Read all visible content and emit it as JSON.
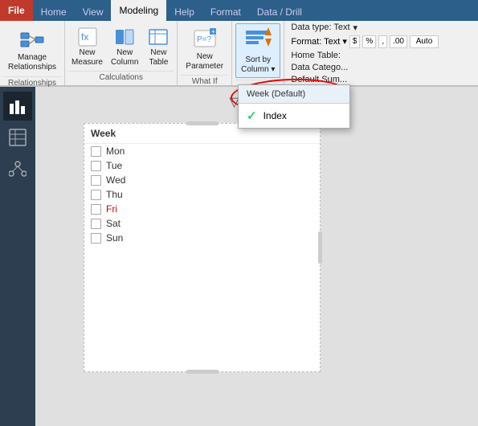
{
  "tabs": [
    {
      "label": "File",
      "active": false,
      "id": "file"
    },
    {
      "label": "Home",
      "active": false,
      "id": "home"
    },
    {
      "label": "View",
      "active": false,
      "id": "view"
    },
    {
      "label": "Modeling",
      "active": true,
      "id": "modeling"
    },
    {
      "label": "Help",
      "active": false,
      "id": "help"
    },
    {
      "label": "Format",
      "active": false,
      "id": "format"
    },
    {
      "label": "Data / Drill",
      "active": false,
      "id": "data-drill"
    }
  ],
  "ribbon": {
    "groups": [
      {
        "id": "relationships",
        "label": "Relationships",
        "buttons": [
          {
            "id": "manage-relationships",
            "label": "Manage\nRelationships",
            "icon": "rel"
          }
        ]
      },
      {
        "id": "calculations",
        "label": "Calculations",
        "buttons": [
          {
            "id": "new-measure",
            "label": "New\nMeasure",
            "icon": "measure"
          },
          {
            "id": "new-column",
            "label": "New\nColumn",
            "icon": "column"
          },
          {
            "id": "new-table",
            "label": "New\nTable",
            "icon": "table"
          }
        ]
      },
      {
        "id": "what-if",
        "label": "What If",
        "buttons": [
          {
            "id": "new-parameter",
            "label": "New\nParameter",
            "icon": "param"
          }
        ]
      },
      {
        "id": "sort",
        "label": "",
        "buttons": [
          {
            "id": "sort-by-column",
            "label": "Sort by\nColumn",
            "icon": "sort"
          }
        ]
      }
    ],
    "right_panel": {
      "data_type_label": "Data type: Text",
      "format_label": "Format: Text",
      "home_table_label": "Home Table:",
      "data_category_label": "Data Catego...",
      "default_sum_label": "Default Sum..."
    },
    "format_bar": {
      "dollar": "$",
      "percent": "%",
      "comma": ",",
      "decimal_more": ".00",
      "auto_label": "Auto"
    }
  },
  "dropdown": {
    "header": "Week (Default)",
    "items": [
      {
        "id": "index",
        "label": "Index",
        "checked": true
      }
    ]
  },
  "sidebar": {
    "icons": [
      {
        "id": "bar-chart",
        "symbol": "▦",
        "active": true
      },
      {
        "id": "table-view",
        "symbol": "⊞",
        "active": false
      },
      {
        "id": "model-view",
        "symbol": "⬡",
        "active": false
      }
    ]
  },
  "table": {
    "title": "Week",
    "toolbar": {
      "filter": "▽",
      "expand": "⬚",
      "more": "···"
    },
    "rows": [
      {
        "id": "mon",
        "label": "Mon",
        "color": "normal"
      },
      {
        "id": "tue",
        "label": "Tue",
        "color": "normal"
      },
      {
        "id": "wed",
        "label": "Wed",
        "color": "normal"
      },
      {
        "id": "thu",
        "label": "Thu",
        "color": "normal"
      },
      {
        "id": "fri",
        "label": "Fri",
        "color": "red"
      },
      {
        "id": "sat",
        "label": "Sat",
        "color": "normal"
      },
      {
        "id": "sun",
        "label": "Sun",
        "color": "normal"
      }
    ]
  }
}
